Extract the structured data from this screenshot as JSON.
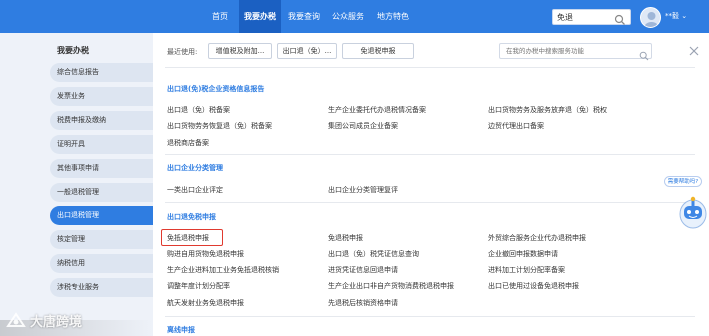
{
  "topnav": {
    "items": [
      {
        "label": "首页"
      },
      {
        "label": "我要办税"
      },
      {
        "label": "我要查询"
      },
      {
        "label": "公众服务"
      },
      {
        "label": "地方特色"
      }
    ],
    "search_value": "免退",
    "user_name": "**毅 ⌄"
  },
  "sidebar": {
    "title": "我要办税",
    "items": [
      {
        "label": "综合信息报告"
      },
      {
        "label": "发票业务"
      },
      {
        "label": "税费申报及缴纳"
      },
      {
        "label": "证明开具"
      },
      {
        "label": "其他事项申请"
      },
      {
        "label": "一般退税管理"
      },
      {
        "label": "出口退税管理"
      },
      {
        "label": "核定管理"
      },
      {
        "label": "纳税信用"
      },
      {
        "label": "涉税专业服务"
      }
    ]
  },
  "main": {
    "recent_label": "最近使用:",
    "recent": [
      "增值税及附加...",
      "出口退（免）...",
      "免退税申报"
    ],
    "search_placeholder": "在我的办税中搜索服务功能",
    "sections": [
      {
        "title": "出口退(免)税企业资格信息报告",
        "links": [
          "出口退（免）税备案",
          "生产企业委托代办退税情况备案",
          "出口货物劳务及服务放弃退（免）税权",
          "出口货物劳务恢复退（免）税备案",
          "集团公司成员企业备案",
          "边贸代理出口备案",
          "退税商店备案"
        ]
      },
      {
        "title": "出口企业分类管理",
        "links": [
          "一类出口企业评定",
          "出口企业分类管理复评"
        ]
      },
      {
        "title": "出口退免税申报",
        "links": [
          "免抵退税申报",
          "免退税申报",
          "外贸综合服务企业代办退税申报",
          "购进自用货物免退税申报",
          "出口退（免）税凭证信息查询",
          "企业撤回申报数据申请",
          "生产企业进料加工业务免抵退税核销",
          "进货凭证信息回退申请",
          "进料加工计划分配率备案",
          "调整年度计划分配率",
          "生产企业出口非自产货物消费税退税申报",
          "出口已使用过设备免退税申报",
          "航天发射业务免退税申报",
          "先退税后核销资格申请"
        ]
      },
      {
        "title": "离线申报",
        "links": []
      }
    ]
  },
  "assistant": {
    "bubble": "需要帮助吗?"
  },
  "watermark": "大唐跨境",
  "colors": {
    "primary": "#2f7de1",
    "nav_active": "#1b60c2",
    "highlight": "#e03a2f"
  },
  "icons": [
    "search-icon",
    "close-icon",
    "avatar-icon",
    "robot-assistant-icon",
    "watermark-logo-icon"
  ]
}
